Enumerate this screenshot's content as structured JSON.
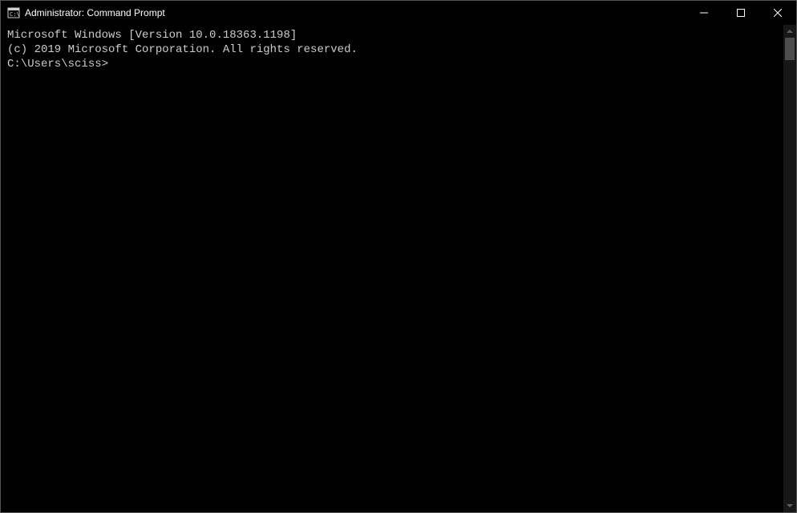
{
  "titlebar": {
    "title": "Administrator: Command Prompt"
  },
  "terminal": {
    "line1": "Microsoft Windows [Version 10.0.18363.1198]",
    "line2_part1": "(c) 2019 Microsoft Corporation. All rights reserved",
    "line2_period": ".",
    "blank": "",
    "prompt": "C:\\Users\\sciss>"
  }
}
